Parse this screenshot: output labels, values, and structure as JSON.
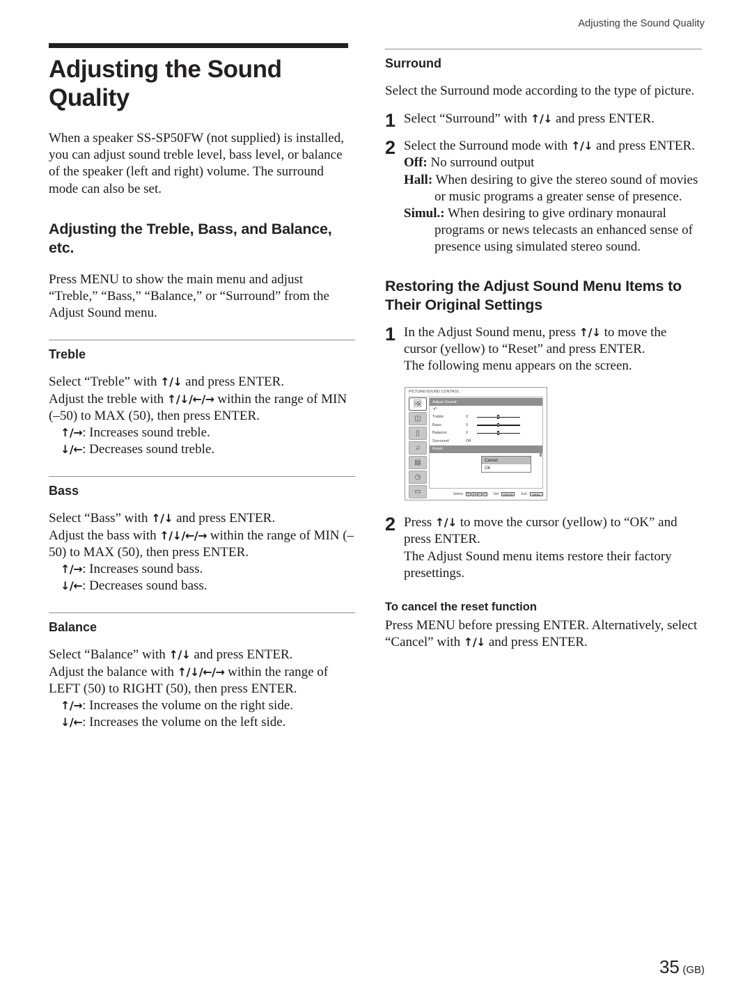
{
  "running_head": "Adjusting the Sound Quality",
  "folio": {
    "page": "35",
    "region": "(GB)"
  },
  "left_column": {
    "chapter_title": "Adjusting the Sound Quality",
    "intro": "When a speaker SS-SP50FW (not supplied) is installed, you can adjust sound treble level, bass level, or balance of the speaker (left and right) volume. The surround mode can also be set.",
    "section_title": "Adjusting the Treble, Bass, and Balance, etc.",
    "section_intro": "Press MENU to show the main menu and adjust “Treble,” “Bass,” “Balance,” or “Surround” from the Adjust Sound menu.",
    "treble": {
      "heading": "Treble",
      "line1_a": "Select “Treble” with ",
      "line1_arrows": "↑/↓",
      "line1_b": " and press ENTER.",
      "line2_a": "Adjust the treble with ",
      "line2_arrows": "↑/↓/←/→",
      "line2_b": " within the range of MIN (–50) to MAX (50), then press ENTER.",
      "bullet1_arrows": "↑/→",
      "bullet1_text": ": Increases sound treble.",
      "bullet2_arrows": "↓/←",
      "bullet2_text": ": Decreases sound treble."
    },
    "bass": {
      "heading": "Bass",
      "line1_a": "Select “Bass” with ",
      "line1_arrows": "↑/↓",
      "line1_b": " and press ENTER.",
      "line2_a": "Adjust the bass with ",
      "line2_arrows": "↑/↓/←/→",
      "line2_b": " within the range of MIN (–50) to MAX (50), then press ENTER.",
      "bullet1_arrows": "↑/→",
      "bullet1_text": ": Increases sound bass.",
      "bullet2_arrows": "↓/←",
      "bullet2_text": ": Decreases sound bass."
    },
    "balance": {
      "heading": "Balance",
      "line1_a": "Select “Balance” with ",
      "line1_arrows": "↑/↓",
      "line1_b": " and press ENTER.",
      "line2_a": "Adjust the balance with ",
      "line2_arrows": "↑/↓/←/→",
      "line2_b": " within the range of LEFT (50) to RIGHT (50), then press ENTER.",
      "bullet1_arrows": "↑/→",
      "bullet1_text": ": Increases the volume on the right side.",
      "bullet2_arrows": "↓/←",
      "bullet2_text": ": Increases the volume on the left side."
    }
  },
  "right_column": {
    "surround": {
      "heading": "Surround",
      "intro": "Select the Surround mode according to the type of picture.",
      "step1_num": "1",
      "step1_a": "Select “Surround” with ",
      "step1_arrows": "↑/↓",
      "step1_b": " and press ENTER.",
      "step2_num": "2",
      "step2_a": "Select the Surround mode with ",
      "step2_arrows": "↑/↓",
      "step2_b": " and press ENTER.",
      "modes": [
        {
          "name": "Off:",
          "desc": " No surround output"
        },
        {
          "name": "Hall:",
          "desc": " When desiring to give the stereo sound of movies or music programs a greater sense of presence."
        },
        {
          "name": "Simul.:",
          "desc": " When desiring to give ordinary monaural programs or news telecasts an enhanced sense of presence using simulated stereo sound."
        }
      ]
    },
    "restoring": {
      "heading": "Restoring the Adjust Sound Menu Items to Their Original Settings",
      "step1_num": "1",
      "step1_a": "In the Adjust Sound menu, press ",
      "step1_arrows": "↑/↓",
      "step1_b": " to move the cursor (yellow) to “Reset” and press ENTER.",
      "step1_c": "The following menu appears on the screen.",
      "step2_num": "2",
      "step2_a": "Press ",
      "step2_arrows": "↑/↓",
      "step2_b": " to move the cursor (yellow) to “OK” and press ENTER.",
      "step2_c": "The Adjust Sound menu items restore their factory presettings.",
      "cancel_heading": "To cancel the reset function",
      "cancel_a": "Press MENU before pressing ENTER. Alternatively, select “Cancel” with ",
      "cancel_arrows": "↑/↓",
      "cancel_b": " and press ENTER."
    },
    "osd_figure": {
      "title": "PICTURE/SOUND CONTROL",
      "menu_header": "Adjust Sound",
      "return_glyph": "↶",
      "rows": [
        {
          "label": "Treble:",
          "value": "0",
          "slider": true
        },
        {
          "label": "Bass:",
          "value": "0",
          "slider": true
        },
        {
          "label": "Balance:",
          "value": "0",
          "slider": true
        },
        {
          "label": "Surround:",
          "value": "Off",
          "slider": false
        },
        {
          "label": "Reset",
          "value": "",
          "slider": false,
          "highlighted": true
        }
      ],
      "popup": [
        {
          "label": "Cancel",
          "selected": true
        },
        {
          "label": "OK",
          "selected": false
        }
      ],
      "sidebar_icons": [
        "picture-control-icon",
        "screen-control-icon",
        "input-setting-icon",
        "sound-control-icon",
        "memory-icon",
        "timer-icon",
        "option-icon"
      ],
      "footer": {
        "select_label": "Select :",
        "select_keys": [
          "↑",
          "↓",
          "←",
          "→"
        ],
        "set_label": "Set :",
        "set_key": "ENTER",
        "exit_label": "Exit :",
        "exit_key": "MENU"
      }
    }
  }
}
